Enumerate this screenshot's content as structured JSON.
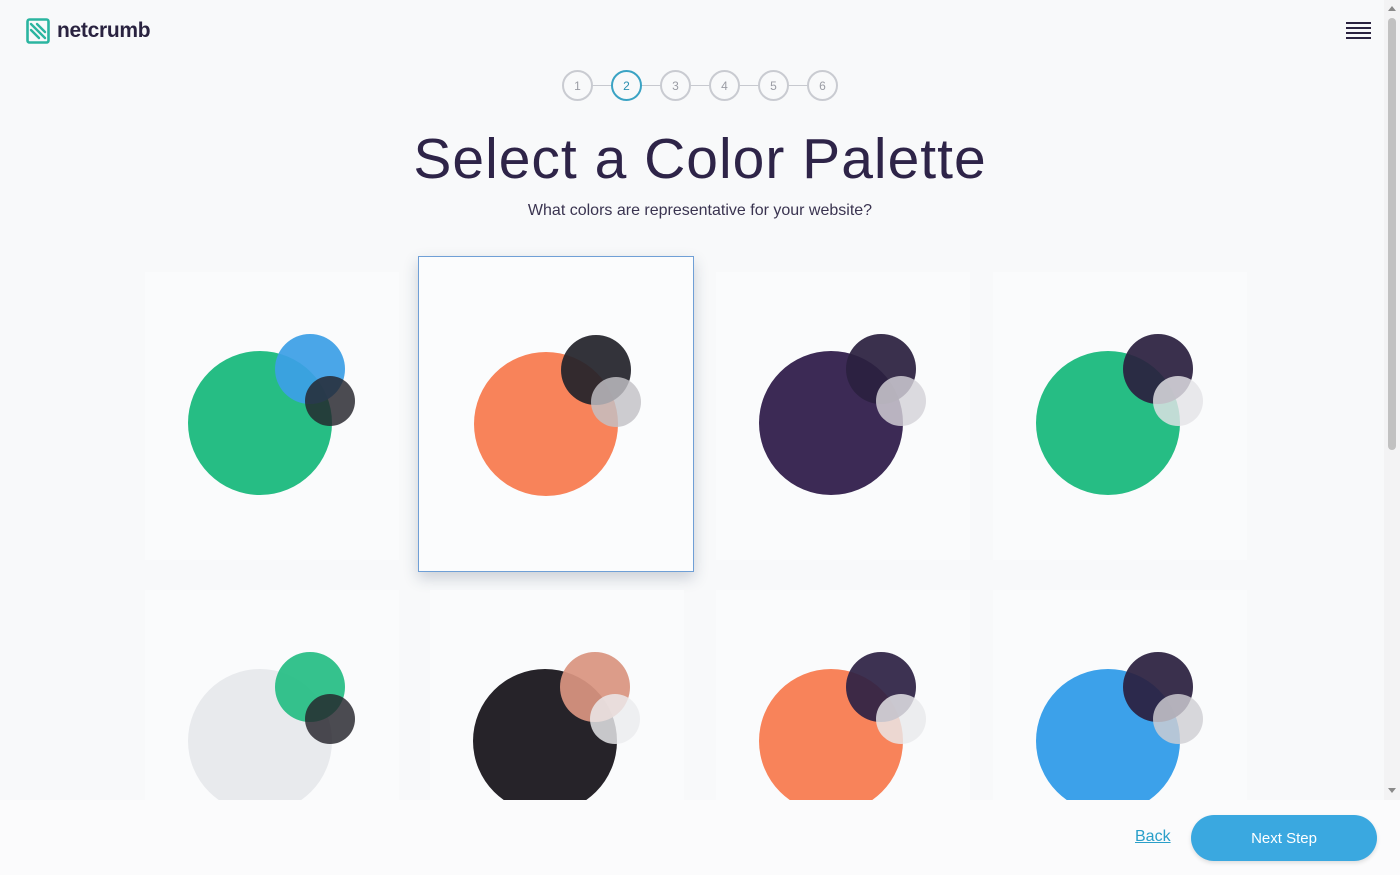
{
  "brand": {
    "name": "netcrumb",
    "accent_color": "#2bb5a0"
  },
  "header": {
    "menu_icon": "hamburger-menu-icon"
  },
  "steps": [
    "1",
    "2",
    "3",
    "4",
    "5",
    "6"
  ],
  "current_step": "2",
  "title": "Select a Color Palette",
  "subtitle": "What colors are representative for your website?",
  "palettes": [
    {
      "colors": [
        "#26bd84",
        "#3c9fe6",
        "#24232b"
      ],
      "selected": false
    },
    {
      "colors": [
        "#f8835a",
        "#24232b",
        "#c2c1c6"
      ],
      "selected": true
    },
    {
      "colors": [
        "#3c2a55",
        "#2b2040",
        "#d4d2d8"
      ],
      "selected": false
    },
    {
      "colors": [
        "#26bd84",
        "#2b2040",
        "#e4e3e6"
      ],
      "selected": false
    },
    {
      "colors": [
        "#e8eaed",
        "#26bd84",
        "#24232b"
      ],
      "selected": false
    },
    {
      "colors": [
        "#262329",
        "#d99480",
        "#ecebee"
      ],
      "selected": false
    },
    {
      "colors": [
        "#f8835a",
        "#2e2245",
        "#e9e9ec"
      ],
      "selected": false
    },
    {
      "colors": [
        "#3ca1ea",
        "#2b2040",
        "#cfced3"
      ],
      "selected": false
    }
  ],
  "footer": {
    "back_label": "Back",
    "next_label": "Next Step",
    "next_color": "#3aa8e0",
    "link_color": "#2a9fc9"
  }
}
